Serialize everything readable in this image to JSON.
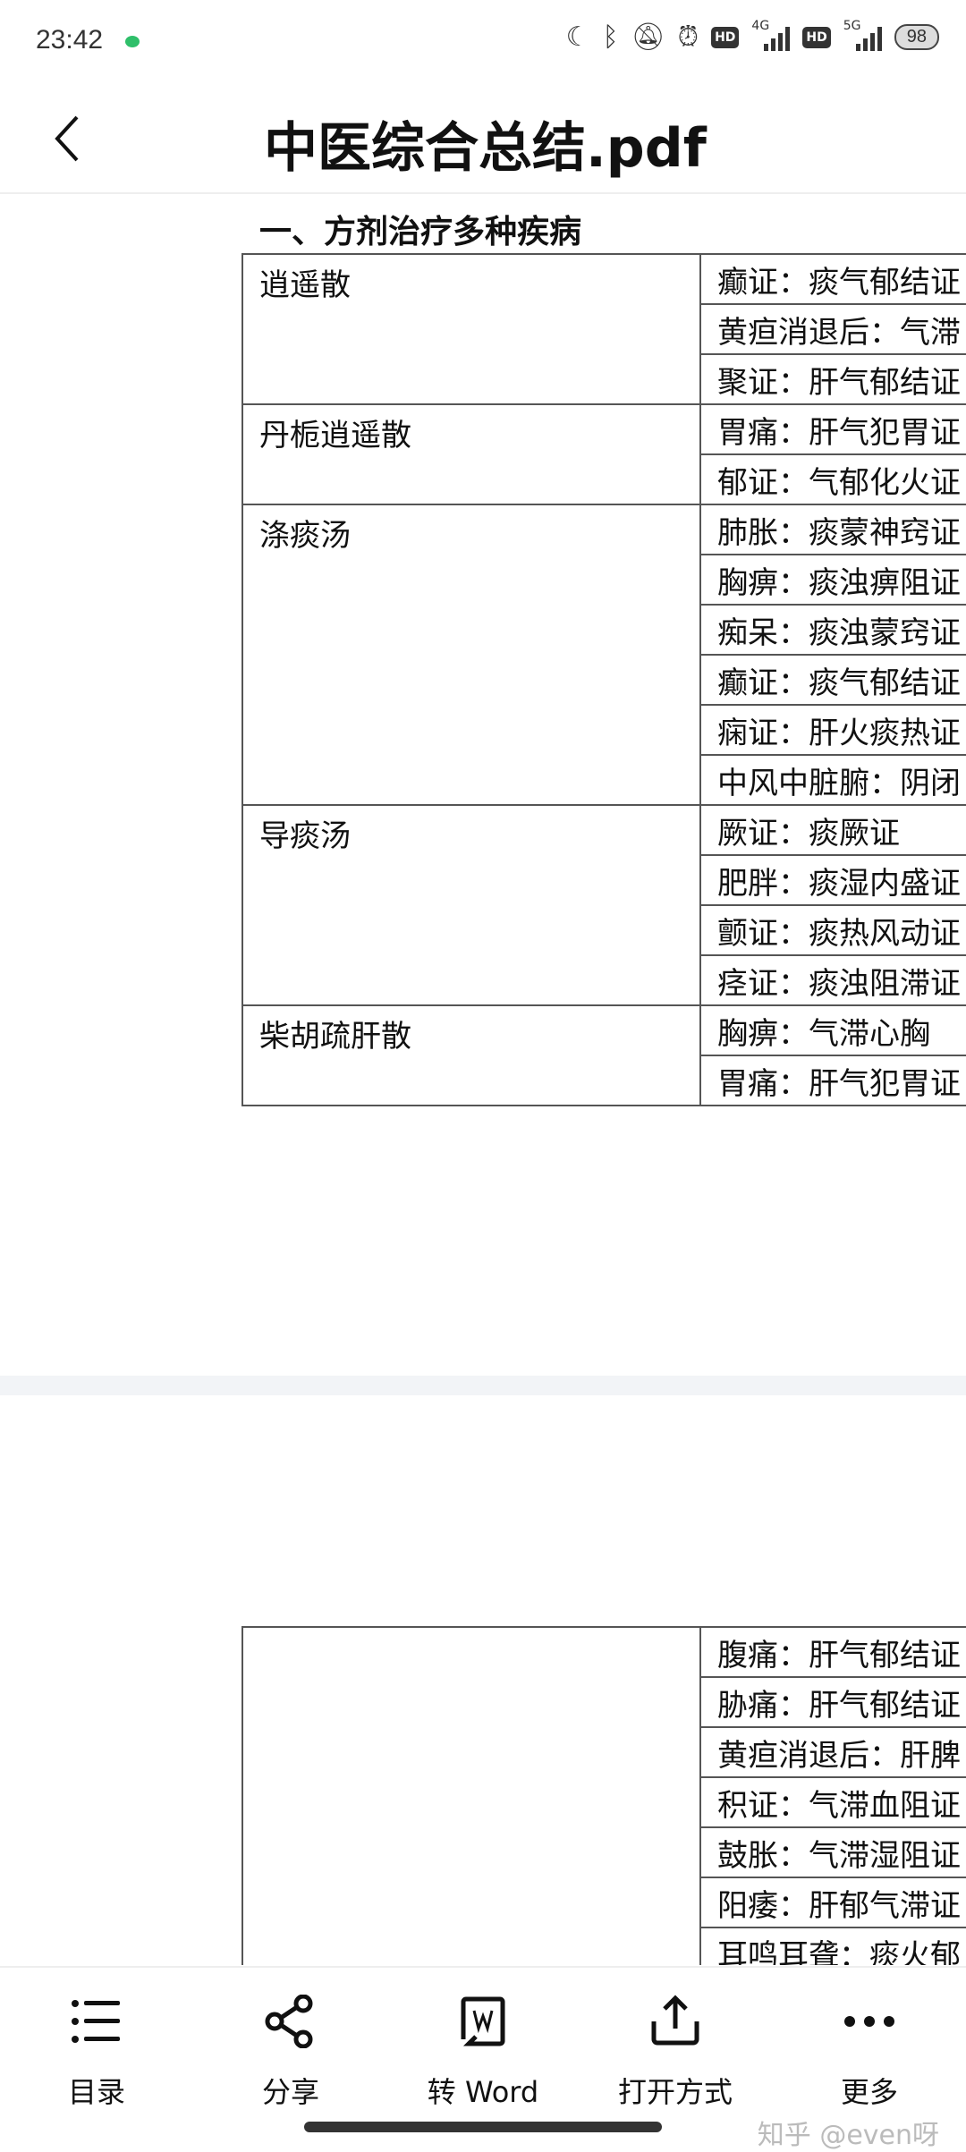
{
  "status_bar": {
    "time": "23:42",
    "battery": "98",
    "net1": "4G",
    "net2": "5G",
    "hd": "HD"
  },
  "header": {
    "title": "中医综合总结.pdf"
  },
  "document": {
    "heading": "一、方剂治疗多种疾病",
    "table1": [
      {
        "name": "逍遥散",
        "items": [
          "癫证：痰气郁结证",
          "黄疸消退后：气滞",
          "聚证：肝气郁结证"
        ]
      },
      {
        "name": "丹栀逍遥散",
        "items": [
          "胃痛：肝气犯胃证",
          "郁证：气郁化火证"
        ]
      },
      {
        "name": "涤痰汤",
        "items": [
          "肺胀：痰蒙神窍证",
          "胸痹：痰浊痹阻证",
          "痴呆：痰浊蒙窍证",
          "癫证：痰气郁结证",
          "痫证：肝火痰热证",
          "中风中脏腑：阴闭"
        ]
      },
      {
        "name": "导痰汤",
        "items": [
          "厥证：痰厥证",
          "肥胖：痰湿内盛证",
          "颤证：痰热风动证",
          "痉证：痰浊阻滞证"
        ]
      },
      {
        "name": "柴胡疏肝散",
        "items": [
          "胸痹：气滞心胸",
          "胃痛：肝气犯胃证"
        ]
      }
    ],
    "table2": [
      {
        "name": "",
        "items": [
          "腹痛：肝气郁结证",
          "胁痛：肝气郁结证",
          "黄疸消退后：肝脾",
          "积证：气滞血阻证",
          "鼓胀：气滞湿阻证",
          "阳痿：肝郁气滞证",
          "耳鸣耳聋：痰火郁"
        ]
      }
    ]
  },
  "toolbar": {
    "items": [
      {
        "label": "目录",
        "icon": "list-icon"
      },
      {
        "label": "分享",
        "icon": "share-icon"
      },
      {
        "label": "转 Word",
        "icon": "word-convert-icon"
      },
      {
        "label": "打开方式",
        "icon": "open-with-icon"
      },
      {
        "label": "更多",
        "icon": "more-icon"
      }
    ]
  },
  "watermark": "知乎 @even呀"
}
